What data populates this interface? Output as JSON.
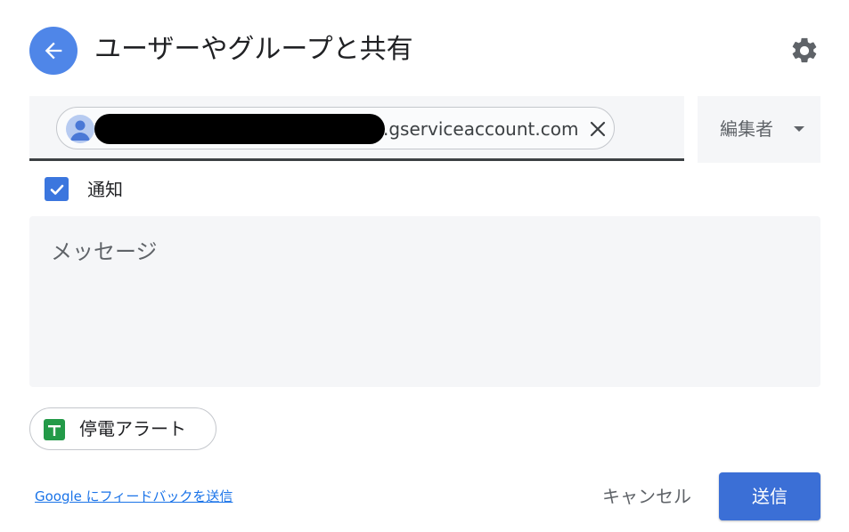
{
  "header": {
    "title": "ユーザーやグループと共有",
    "back_icon": "arrow-left-icon",
    "settings_icon": "gear-icon"
  },
  "recipient": {
    "email_suffix": ".gserviceaccount.com",
    "avatar_icon": "person-icon",
    "remove_icon": "close-icon"
  },
  "role": {
    "selected": "編集者",
    "caret_icon": "caret-down-icon"
  },
  "notify": {
    "label": "通知",
    "checked": true
  },
  "message": {
    "placeholder": "メッセージ"
  },
  "smart_chip": {
    "label": "停電アラート",
    "icon": "sheets-icon"
  },
  "footer": {
    "feedback_link": "Google にフィードバックを送信",
    "cancel_label": "キャンセル",
    "send_label": "送信"
  },
  "colors": {
    "accent": "#3b6fd6",
    "back_button": "#4f86e8",
    "checkbox": "#3b76de",
    "field_bg": "#f5f6f8",
    "sheets_green": "#239a48"
  }
}
